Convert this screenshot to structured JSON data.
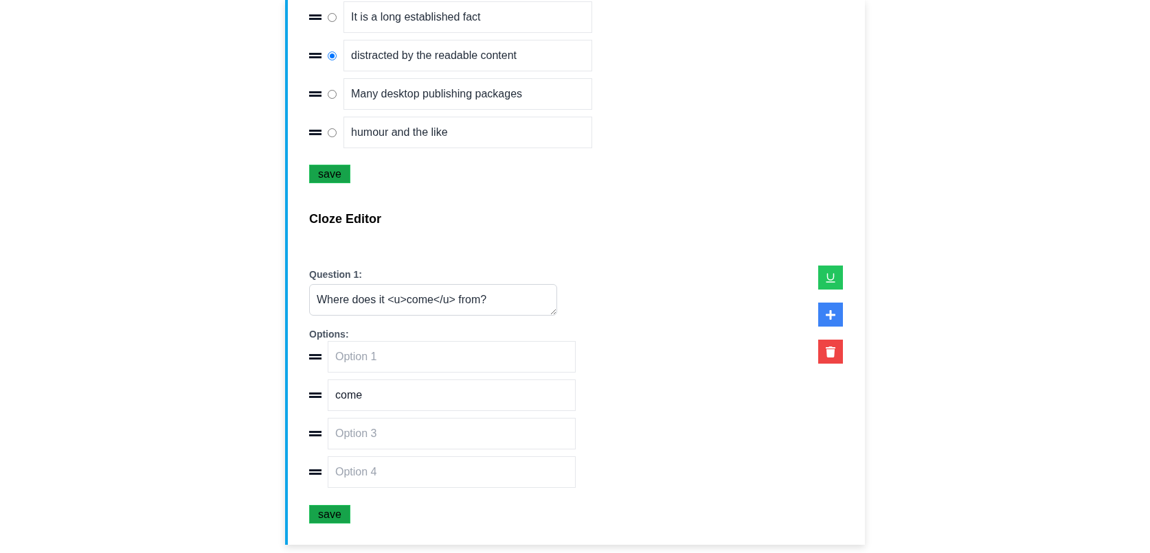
{
  "choice_editor": {
    "options": [
      {
        "text": "It is a long established fact",
        "selected": false
      },
      {
        "text": "distracted by the readable content",
        "selected": true
      },
      {
        "text": "Many desktop publishing packages",
        "selected": false
      },
      {
        "text": "humour and the like",
        "selected": false
      }
    ],
    "save_button": "save"
  },
  "cloze_editor": {
    "title": "Cloze Editor",
    "question_label": "Question 1:",
    "question_value": "Where does it <u>come</u> from?",
    "options_label": "Options:",
    "options": [
      {
        "placeholder": "Option 1"
      },
      {
        "value": "come"
      },
      {
        "placeholder": "Option 3"
      },
      {
        "placeholder": "Option 4"
      }
    ],
    "save_button": "save",
    "tools": [
      {
        "kind": "underline"
      },
      {
        "kind": "add"
      },
      {
        "kind": "delete"
      }
    ]
  }
}
